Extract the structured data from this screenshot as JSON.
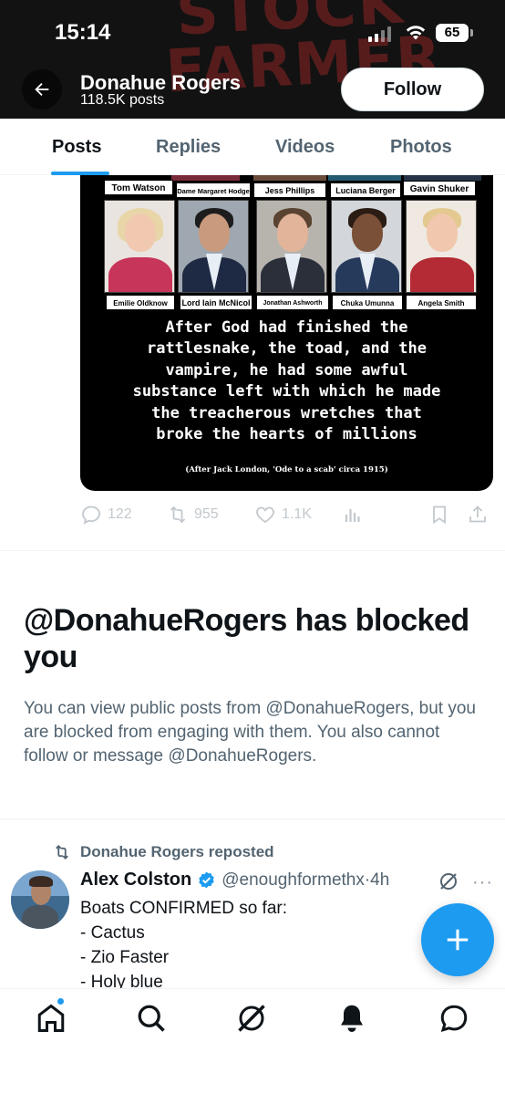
{
  "status_bar": {
    "time": "15:14",
    "battery": "65"
  },
  "banner": {
    "art_lines": [
      "STOCK",
      "FARMER"
    ]
  },
  "header": {
    "name": "Donahue Rogers",
    "posts_count": "118.5K posts",
    "follow_label": "Follow"
  },
  "tabs": [
    {
      "label": "Posts",
      "active": true
    },
    {
      "label": "Replies",
      "active": false
    },
    {
      "label": "Videos",
      "active": false
    },
    {
      "label": "Photos",
      "active": false
    }
  ],
  "media": {
    "row1_names": [
      "Tom Watson",
      "Dame Margaret Hodge",
      "Jess Phillips",
      "Luciana Berger",
      "Gavin Shuker"
    ],
    "row2_names": [
      "Emilie Oldknow",
      "Lord Iain McNicol",
      "Jonathan Ashworth",
      "Chuka Umunna",
      "Angela Smith"
    ],
    "quote_lines": [
      "After God had finished the",
      "rattlesnake, the toad, and the",
      "vampire, he had some awful",
      "substance left with which he made",
      "the treacherous wretches that",
      "broke the hearts of millions"
    ],
    "attribution": "(After Jack London, 'Ode to a scab' circa 1915)"
  },
  "actions": {
    "replies": "122",
    "reposts": "955",
    "likes": "1.1K"
  },
  "blocked": {
    "title": "@DonahueRogers has blocked you",
    "body": "You can view public posts from @DonahueRogers, but you are blocked from engaging with them. You also cannot follow or message @DonahueRogers."
  },
  "repost": {
    "label": "Donahue Rogers reposted",
    "author": "Alex Colston",
    "handle": "@enoughformethx",
    "time": "·4h",
    "text_lines": [
      "Boats CONFIRMED so far:",
      "- Cactus",
      "- Zio Faster",
      "- Holy blue"
    ]
  },
  "colors": {
    "accent": "#1d9bf0",
    "text": "#0f1419",
    "muted": "#536471"
  },
  "nav": [
    "home-icon",
    "search-icon",
    "grok-icon",
    "notifications-icon",
    "messages-icon"
  ]
}
